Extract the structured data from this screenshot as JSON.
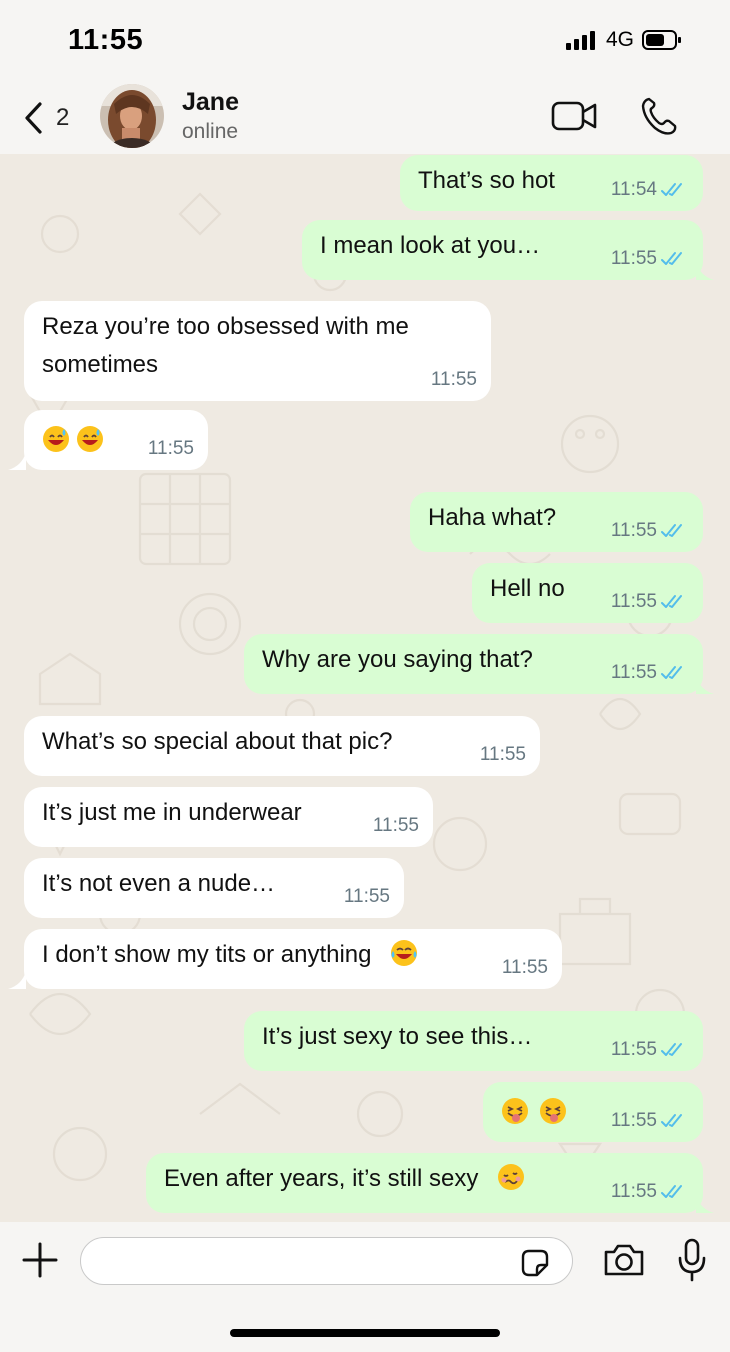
{
  "status_bar": {
    "time": "11:55",
    "network": "4G"
  },
  "header": {
    "back_count": "2",
    "contact_name": "Jane",
    "contact_status": "online"
  },
  "messages": [
    {
      "dir": "out",
      "text": "That’s so hot",
      "time": "11:54",
      "read": true
    },
    {
      "dir": "out",
      "text": "I mean look at you…",
      "time": "11:55",
      "read": true
    },
    {
      "dir": "in",
      "line1": "Reza you’re too obsessed with me",
      "line2": "sometimes",
      "time": "11:55"
    },
    {
      "dir": "in",
      "emojis": [
        "smiling-face-with-sweat-emoji",
        "smiling-face-with-sweat-emoji"
      ],
      "time": "11:55"
    },
    {
      "dir": "out",
      "text": "Haha what?",
      "time": "11:55",
      "read": true
    },
    {
      "dir": "out",
      "text": "Hell no",
      "time": "11:55",
      "read": true
    },
    {
      "dir": "out",
      "text": "Why are you saying that?",
      "time": "11:55",
      "read": true
    },
    {
      "dir": "in",
      "text": "What’s so special about that pic?",
      "time": "11:55"
    },
    {
      "dir": "in",
      "text": "It’s just me in underwear",
      "time": "11:55"
    },
    {
      "dir": "in",
      "text": "It’s not even a nude…",
      "time": "11:55"
    },
    {
      "dir": "in",
      "text": "I don’t show my tits or anything",
      "emoji": "tears-of-joy-emoji",
      "time": "11:55"
    },
    {
      "dir": "out",
      "text": "It’s just sexy to see this…",
      "time": "11:55",
      "read": true
    },
    {
      "dir": "out",
      "emojis": [
        "tongue-out-emoji",
        "tongue-out-emoji"
      ],
      "time": "11:55",
      "read": true
    },
    {
      "dir": "out",
      "text": "Even after years, it’s still sexy",
      "emoji": "woozy-face-emoji",
      "time": "11:55",
      "read": true
    }
  ],
  "composer": {
    "value": "",
    "placeholder": ""
  },
  "colors": {
    "outgoing_bubble": "#d9fdd3",
    "incoming_bubble": "#ffffff",
    "read_ticks": "#53bdeb",
    "chat_bg": "#efeae2"
  },
  "icons": {
    "back": "chevron-left-icon",
    "video": "video-camera-icon",
    "call": "phone-icon",
    "plus": "plus-icon",
    "sticker": "sticker-icon",
    "camera": "camera-icon",
    "mic": "microphone-icon"
  }
}
